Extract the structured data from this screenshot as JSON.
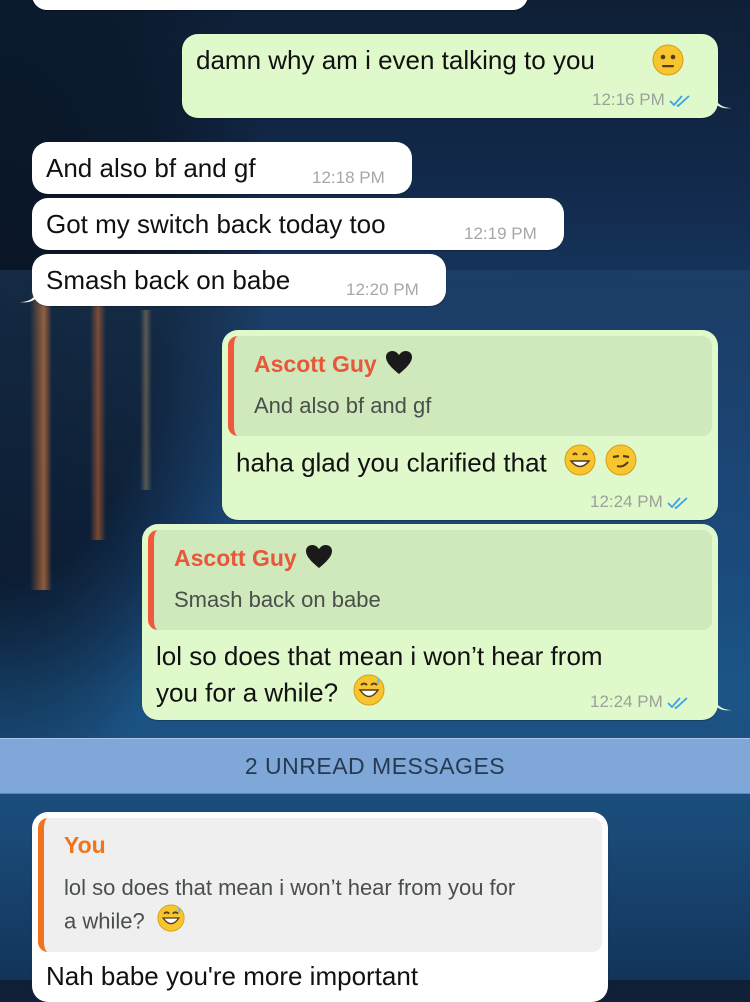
{
  "messages": [
    {
      "dir": "out",
      "text": "damn why am i even talking to you",
      "time": "12:16 PM"
    },
    {
      "dir": "in",
      "text": "And also bf and gf",
      "time": "12:18 PM"
    },
    {
      "dir": "in",
      "text": "Got my switch back today too",
      "time": "12:19 PM"
    },
    {
      "dir": "in",
      "text": "Smash back on babe",
      "time": "12:20 PM"
    },
    {
      "dir": "out",
      "reply_name": "Ascott Guy",
      "reply_text": "And also bf and gf",
      "text": "haha glad you clarified that",
      "time": "12:24 PM"
    },
    {
      "dir": "out",
      "reply_name": "Ascott Guy",
      "reply_text": "Smash back on babe",
      "text_line1": "lol so does that mean i won’t hear from",
      "text_line2": "you for a while?",
      "time": "12:24 PM"
    },
    {
      "dir": "in",
      "reply_name": "You",
      "reply_line1": "lol so does that mean i won’t hear from you for",
      "reply_line2": "a while?",
      "text": "Nah babe you're more important"
    }
  ],
  "unread_banner": "2 UNREAD MESSAGES",
  "colors": {
    "outgoing": "#e0f9cb",
    "incoming": "#ffffff",
    "reply_accent_out": "#ef5a3b",
    "reply_accent_in": "#f0731d",
    "unread_bar": "#7fa7d8",
    "tick_blue": "#3ba0e6"
  }
}
